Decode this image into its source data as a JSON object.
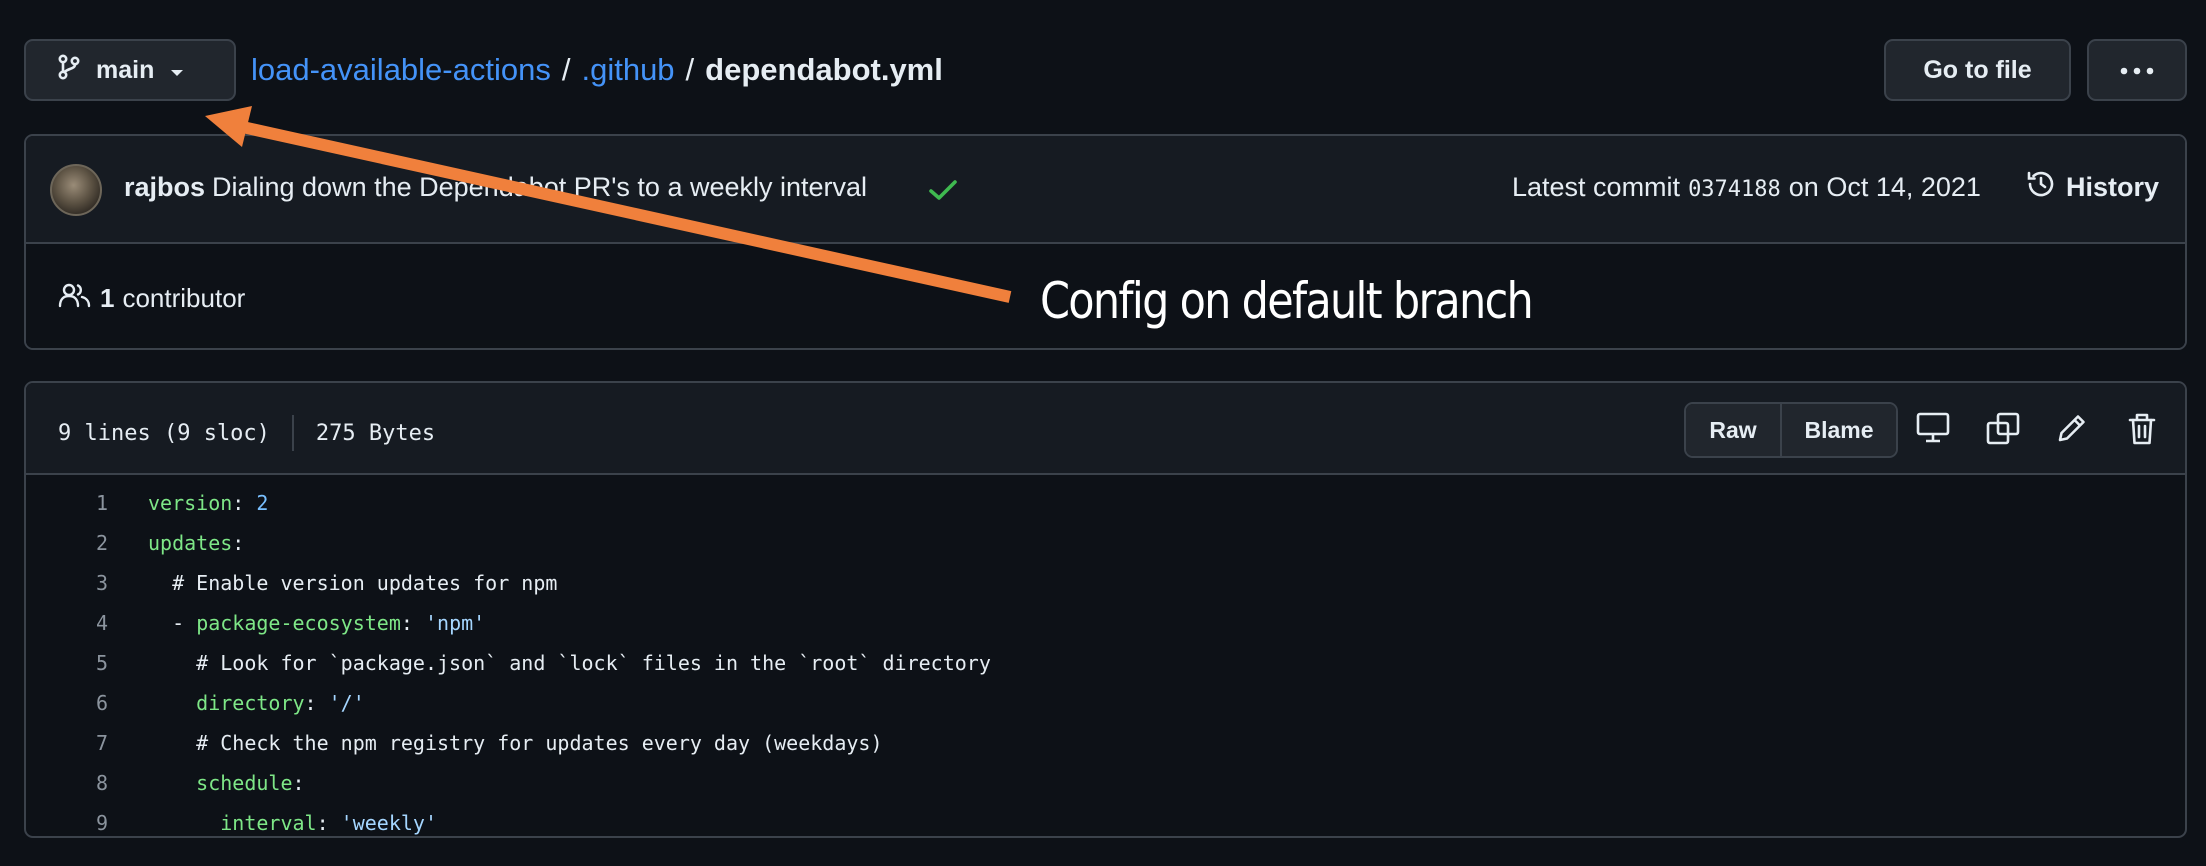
{
  "toolbar": {
    "branch": "main",
    "breadcrumb": {
      "repo": "load-available-actions",
      "folder": ".github",
      "file": "dependabot.yml",
      "separator": "/"
    },
    "goto_file": "Go to file"
  },
  "commit": {
    "author": "rajbos",
    "message": "Dialing down the Dependabot PR's to a weekly interval",
    "latest_label": "Latest commit",
    "sha": "0374188",
    "date_text": "on Oct 14, 2021",
    "history": "History"
  },
  "contributors": {
    "count": "1",
    "label": "contributor"
  },
  "file": {
    "lines": "9 lines (9 sloc)",
    "size": "275 Bytes",
    "raw": "Raw",
    "blame": "Blame"
  },
  "code": [
    {
      "n": "1",
      "indent": "",
      "dash": "",
      "key": "version",
      "sep": ": ",
      "val": "2",
      "valtype": "n",
      "comment": ""
    },
    {
      "n": "2",
      "indent": "",
      "dash": "",
      "key": "updates",
      "sep": ":",
      "val": "",
      "valtype": "",
      "comment": ""
    },
    {
      "n": "3",
      "indent": "  ",
      "dash": "",
      "key": "",
      "sep": "",
      "val": "",
      "valtype": "",
      "comment": "# Enable version updates for npm"
    },
    {
      "n": "4",
      "indent": "  ",
      "dash": "- ",
      "key": "package-ecosystem",
      "sep": ": ",
      "val": "'npm'",
      "valtype": "s",
      "comment": ""
    },
    {
      "n": "5",
      "indent": "    ",
      "dash": "",
      "key": "",
      "sep": "",
      "val": "",
      "valtype": "",
      "comment": "# Look for `package.json` and `lock` files in the `root` directory"
    },
    {
      "n": "6",
      "indent": "    ",
      "dash": "",
      "key": "directory",
      "sep": ": ",
      "val": "'/'",
      "valtype": "s",
      "comment": ""
    },
    {
      "n": "7",
      "indent": "    ",
      "dash": "",
      "key": "",
      "sep": "",
      "val": "",
      "valtype": "",
      "comment": "# Check the npm registry for updates every day (weekdays)"
    },
    {
      "n": "8",
      "indent": "    ",
      "dash": "",
      "key": "schedule",
      "sep": ":",
      "val": "",
      "valtype": "",
      "comment": ""
    },
    {
      "n": "9",
      "indent": "      ",
      "dash": "",
      "key": "interval",
      "sep": ": ",
      "val": "'weekly'",
      "valtype": "s",
      "comment": ""
    }
  ],
  "annotation": {
    "text": "Config on default branch",
    "arrow_color": "#f0803c"
  },
  "colors": {
    "bg": "#0d1117",
    "panel": "#161b22",
    "border": "#3b424b",
    "link": "#4493f8",
    "success": "#3fb950",
    "yaml_key": "#7ee787",
    "yaml_string": "#a5d6ff"
  }
}
